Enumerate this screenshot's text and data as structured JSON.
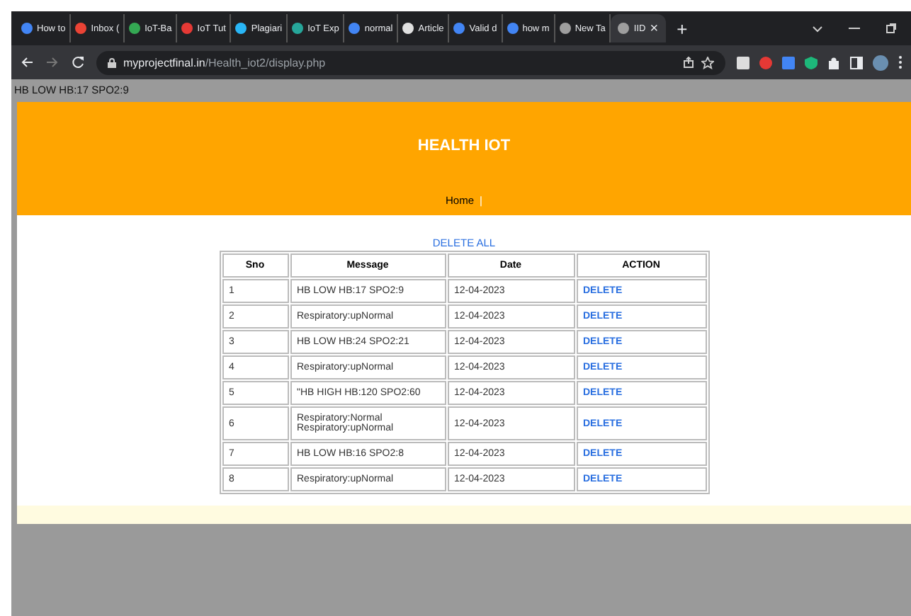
{
  "browser": {
    "tabs": [
      {
        "label": "How to",
        "selected": false,
        "color": "#4285f4"
      },
      {
        "label": "Inbox (",
        "selected": false,
        "color": "#ea4335"
      },
      {
        "label": "IoT-Ba",
        "selected": false,
        "color": "#34a853"
      },
      {
        "label": "IoT Tut",
        "selected": false,
        "color": "#e53935"
      },
      {
        "label": "Plagiari",
        "selected": false,
        "color": "#29b6f6"
      },
      {
        "label": "IoT Exp",
        "selected": false,
        "color": "#26a69a"
      },
      {
        "label": "normal",
        "selected": false,
        "color": "#4285f4"
      },
      {
        "label": "Article",
        "selected": false,
        "color": "#e0e0e0"
      },
      {
        "label": "Valid d",
        "selected": false,
        "color": "#4285f4"
      },
      {
        "label": "how m",
        "selected": false,
        "color": "#4285f4"
      },
      {
        "label": "New Ta",
        "selected": false,
        "color": "#9e9e9e"
      },
      {
        "label": "IID",
        "selected": true,
        "color": "#9e9e9e"
      }
    ],
    "close_glyph": "×",
    "new_tab_glyph": "+",
    "url_host": "myprojectfinal.in",
    "url_path": "/Health_iot2/display.php"
  },
  "page": {
    "top_message": "HB LOW HB:17 SPO2:9",
    "title": "HEALTH IOT",
    "nav": [
      {
        "label": "Home"
      }
    ],
    "nav_separator": "|",
    "delete_all": "DELETE ALL",
    "table": {
      "columns": [
        "Sno",
        "Message",
        "Date",
        "ACTION"
      ],
      "rows": [
        {
          "sno": "1",
          "message": [
            "HB LOW HB:17 SPO2:9"
          ],
          "date": "12-04-2023",
          "action": "DELETE"
        },
        {
          "sno": "2",
          "message": [
            "Respiratory:upNormal"
          ],
          "date": "12-04-2023",
          "action": "DELETE"
        },
        {
          "sno": "3",
          "message": [
            "HB LOW HB:24 SPO2:21"
          ],
          "date": "12-04-2023",
          "action": "DELETE"
        },
        {
          "sno": "4",
          "message": [
            "Respiratory:upNormal"
          ],
          "date": "12-04-2023",
          "action": "DELETE"
        },
        {
          "sno": "5",
          "message": [
            "\"HB HIGH HB:120 SPO2:60"
          ],
          "date": "12-04-2023",
          "action": "DELETE"
        },
        {
          "sno": "6",
          "message": [
            "Respiratory:Normal",
            "Respiratory:upNormal"
          ],
          "date": "12-04-2023",
          "action": "DELETE"
        },
        {
          "sno": "7",
          "message": [
            "HB LOW HB:16 SPO2:8"
          ],
          "date": "12-04-2023",
          "action": "DELETE"
        },
        {
          "sno": "8",
          "message": [
            "Respiratory:upNormal"
          ],
          "date": "12-04-2023",
          "action": "DELETE"
        }
      ]
    }
  }
}
